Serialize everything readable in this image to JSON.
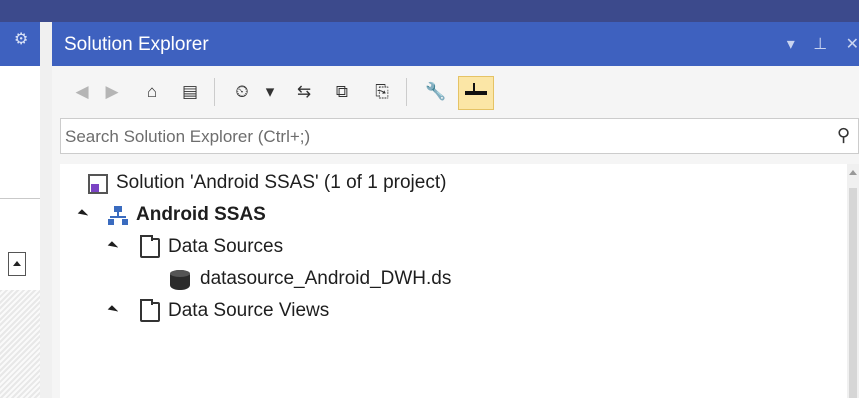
{
  "colors": {
    "title_bar": "#3e61bf",
    "active_button": "#fbe6a6",
    "project_icon": "#3a6bbf",
    "solution_badge": "#7b44c4"
  },
  "left_panel": {
    "gear_icon": "gear-icon"
  },
  "panel": {
    "title": "Solution Explorer",
    "title_icons": [
      "dropdown-arrow-icon",
      "pin-icon",
      "close-icon"
    ]
  },
  "toolbar": {
    "back": "◀",
    "forward": "▶",
    "home": "⌂",
    "switch_views": "▤",
    "pending_changes": "⏲",
    "pending_dropdown": "▾",
    "sync": "⇆",
    "collapse_all": "⧉",
    "show_all_files": "⎘",
    "properties": "🔧"
  },
  "search": {
    "placeholder": "Search Solution Explorer (Ctrl+;)",
    "icon": "search-icon"
  },
  "tree": [
    {
      "label": "Solution 'Android SSAS' (1 of 1 project)",
      "icon": "solution-icon",
      "expanded": null
    },
    {
      "label": "Android SSAS",
      "icon": "project-icon",
      "expanded": true,
      "bold": true
    },
    {
      "label": "Data Sources",
      "icon": "folder-icon",
      "expanded": true
    },
    {
      "label": "datasource_Android_DWH.ds",
      "icon": "database-icon",
      "expanded": null
    },
    {
      "label": "Data Source Views",
      "icon": "folder-icon",
      "expanded": true
    }
  ]
}
